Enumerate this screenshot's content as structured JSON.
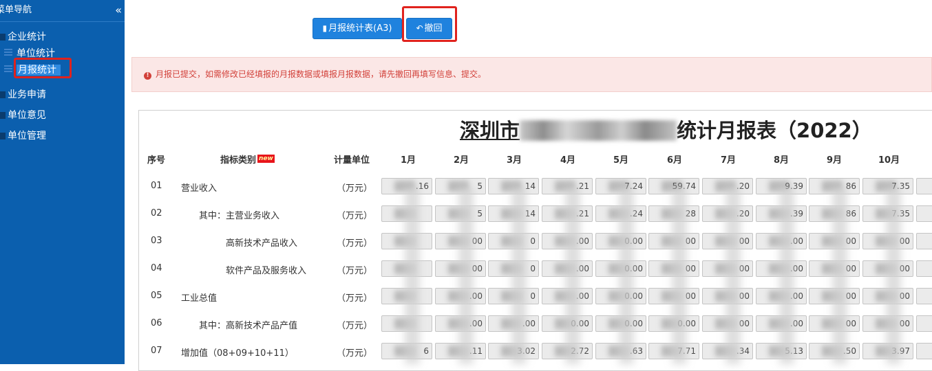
{
  "sidebar": {
    "title": "菜单导航",
    "collapse_icon": "«",
    "groups": [
      {
        "label": "企业统计",
        "children": [
          {
            "label": "单位统计"
          },
          {
            "label": "月报统计"
          }
        ]
      },
      {
        "label": "业务申请"
      },
      {
        "label": "单位意见"
      },
      {
        "label": "单位管理"
      }
    ]
  },
  "toolbar": {
    "report_button": "月报统计表(A3)",
    "withdraw_button": "撤回"
  },
  "alert": {
    "icon": "!",
    "text": "月报已提交，如需修改已经填报的月报数据或填报月报数据，请先撤回再填写信息、提交。"
  },
  "report": {
    "title_prefix": "深圳市",
    "title_suffix": "统计月报表（2022）",
    "headers": {
      "no": "序号",
      "category": "指标类别",
      "new_badge": "new",
      "unit": "计量单位",
      "months": [
        "1月",
        "2月",
        "3月",
        "4月",
        "5月",
        "6月",
        "7月",
        "8月",
        "9月",
        "10月"
      ]
    },
    "rows": [
      {
        "no": "01",
        "name": "营业收入",
        "unit": "（万元）",
        "values": [
          ".16",
          "5",
          "14",
          ".21",
          "7.24",
          "59.74",
          ".20",
          "9.39",
          "86",
          "7.35"
        ]
      },
      {
        "no": "02",
        "name": "其中：主营业务收入",
        "unit": "（万元）",
        "values": [
          "",
          "5",
          "14",
          ".21",
          ".24",
          "28",
          ".20",
          ".39",
          "86",
          "7.35"
        ]
      },
      {
        "no": "03",
        "name": "高新技术产品收入",
        "unit": "（万元）",
        "values": [
          "",
          "00",
          "0",
          ".00",
          "0.00",
          "00",
          "00",
          ".00",
          "00",
          "00"
        ]
      },
      {
        "no": "04",
        "name": "软件产品及服务收入",
        "unit": "（万元）",
        "values": [
          "",
          "00",
          "0",
          ".00",
          "0.00",
          "00",
          "00",
          ".00",
          "00",
          "00"
        ]
      },
      {
        "no": "05",
        "name": "工业总值",
        "unit": "（万元）",
        "values": [
          "",
          ".00",
          "0",
          ".00",
          "0.00",
          "00",
          "00",
          ".00",
          "00",
          "00"
        ]
      },
      {
        "no": "06",
        "name": "其中：高新技术产品产值",
        "unit": "（万元）",
        "values": [
          "",
          ".00",
          ".00",
          "0.00",
          "0.00",
          "0.00",
          "00",
          ".00",
          "00",
          "00"
        ]
      },
      {
        "no": "07",
        "name": "增加值（08+09+10+11）",
        "unit": "（万元）",
        "values": [
          "6",
          ".11",
          "3.02",
          "2.72",
          ".63",
          "7.71",
          ".34",
          "5.13",
          ".50",
          "3.97"
        ]
      }
    ]
  }
}
